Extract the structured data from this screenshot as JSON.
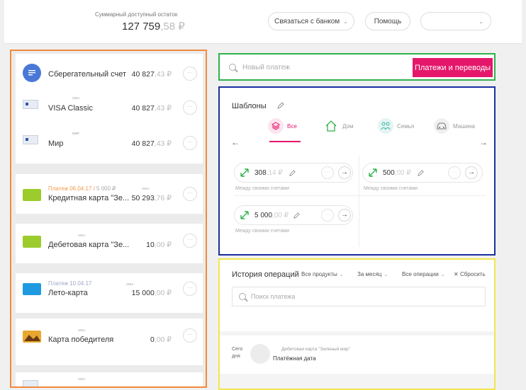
{
  "header": {
    "balance_label": "Суммарный доступный остаток",
    "balance_int": "127 759",
    "balance_dec": ",58 ₽",
    "contact_bank": "Связаться с банком",
    "help": "Помощь",
    "profile_value": ""
  },
  "accounts": {
    "savings": {
      "name": "Сберегательный счет",
      "amount_int": "40 827",
      "amount_dec": ",43 ₽"
    },
    "visa_classic": {
      "tag": "VISA",
      "name": "VISA Classic",
      "amount_int": "40 827",
      "amount_dec": ",43 ₽"
    },
    "mir": {
      "tag": "МИР",
      "name": "Мир",
      "amount_int": "40 827",
      "amount_dec": ",43 ₽"
    },
    "credit": {
      "sub": "Платеж 06.04.17 / ",
      "sub_amount": "5 000 ₽",
      "tag": "VISA",
      "name": "Кредитная карта \"Зе...",
      "amount_int": "50 293",
      "amount_dec": ",76 ₽"
    },
    "debit": {
      "tag": "VISA",
      "name": "Дебетовая карта \"Зе...",
      "amount_int": "10",
      "amount_dec": ",00 ₽"
    },
    "leto": {
      "sub": "Платеж 10.04.17",
      "tag": "VISA",
      "name": "Лето-карта",
      "amount_int": "15 000",
      "amount_dec": ",00 ₽"
    },
    "winner": {
      "tag": "VISA",
      "name": "Карта победителя",
      "amount_int": "0",
      "amount_dec": ",00 ₽"
    },
    "next": {
      "tag": "VISA"
    },
    "more_glyph": "···"
  },
  "payment_bar": {
    "placeholder": "Новый платеж",
    "button": "Платежи и переводы"
  },
  "templates": {
    "title": "Шаблоны",
    "tabs": [
      {
        "label": "Все",
        "icon": "layers-icon"
      },
      {
        "label": "Дом",
        "icon": "home-icon"
      },
      {
        "label": "Семья",
        "icon": "family-icon"
      },
      {
        "label": "Машина",
        "icon": "car-icon"
      }
    ],
    "arrow_left": "←",
    "arrow_right": "→",
    "cards": [
      {
        "amount_int": "308",
        "amount_dec": ",14 ₽",
        "caption": "Между своими счетами"
      },
      {
        "amount_int": "500",
        "amount_dec": ",00 ₽",
        "caption": "Между своими счетами"
      },
      {
        "amount_int": "5 000",
        "amount_dec": ",00 ₽",
        "caption": "Между своими счетами"
      }
    ],
    "go_glyph": "→"
  },
  "history": {
    "title": "История операций",
    "filters": {
      "products": "Все продукты",
      "period": "За месяц",
      "operations": "Все операции",
      "reset": "Сбросить"
    },
    "search_placeholder": "Поиск платежа",
    "op": {
      "date": "Сегодня",
      "source": "Дебетовая карта \"Зеленый мир\"",
      "description": "Платёжная дата"
    }
  },
  "colors": {
    "accent": "#e5176b",
    "green_icon": "#2fb14b",
    "teal_icon": "#38b8a8",
    "savings_icon": "#4a78d8"
  }
}
